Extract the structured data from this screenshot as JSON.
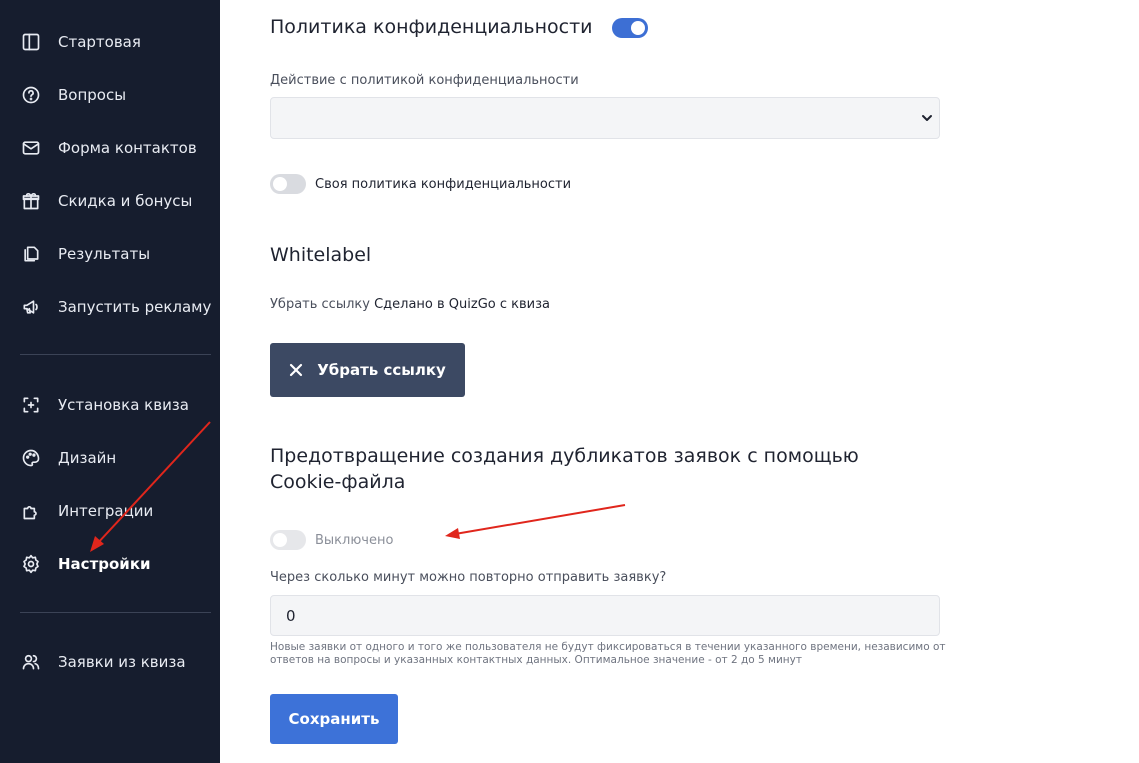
{
  "sidebar": {
    "items": [
      {
        "label": "Стартовая",
        "icon": "layout-icon"
      },
      {
        "label": "Вопросы",
        "icon": "question-circle-icon"
      },
      {
        "label": "Форма контактов",
        "icon": "mail-icon"
      },
      {
        "label": "Скидка и бонусы",
        "icon": "gift-icon"
      },
      {
        "label": "Результаты",
        "icon": "copy-icon"
      },
      {
        "label": "Запустить рекламу",
        "icon": "megaphone-icon"
      },
      {
        "label": "Установка квиза",
        "icon": "add-frame-icon"
      },
      {
        "label": "Дизайн",
        "icon": "palette-icon"
      },
      {
        "label": "Интеграции",
        "icon": "puzzle-icon"
      },
      {
        "label": "Настройки",
        "icon": "gear-icon",
        "active": true
      },
      {
        "label": "Заявки из квиза",
        "icon": "users-icon"
      }
    ]
  },
  "privacy": {
    "title": "Политика конфиденциальности",
    "enabled": true,
    "action_label": "Действие с политикой конфиденциальности",
    "action_value": "",
    "custom_policy_label": "Своя политика конфиденциальности",
    "custom_policy_enabled": false
  },
  "whitelabel": {
    "title": "Whitelabel",
    "desc_prefix": "Убрать ссылку",
    "desc_link": "Сделано в QuizGo с квиза",
    "button_label": "Убрать ссылку"
  },
  "duplicates": {
    "title_line1": "Предотвращение создания дубликатов заявок с помощью",
    "title_line2": "Cookie-файла",
    "toggle_label": "Выключено",
    "enabled": false,
    "minutes_label": "Через сколько минут можно повторно отправить заявку?",
    "minutes_value": "0",
    "hint_line1": "Новые заявки от одного и того же пользователя не будут фиксироваться в течении указанного времени, независимо от",
    "hint_line2": "ответов на вопросы и указанных контактных данных. Оптимальное значение - от 2 до 5 минут"
  },
  "save_label": "Сохранить",
  "colors": {
    "sidebar_bg": "#161d2e",
    "accent": "#3d72d8",
    "dark_button": "#3c4963",
    "annotation_arrow": "#e0261c"
  }
}
